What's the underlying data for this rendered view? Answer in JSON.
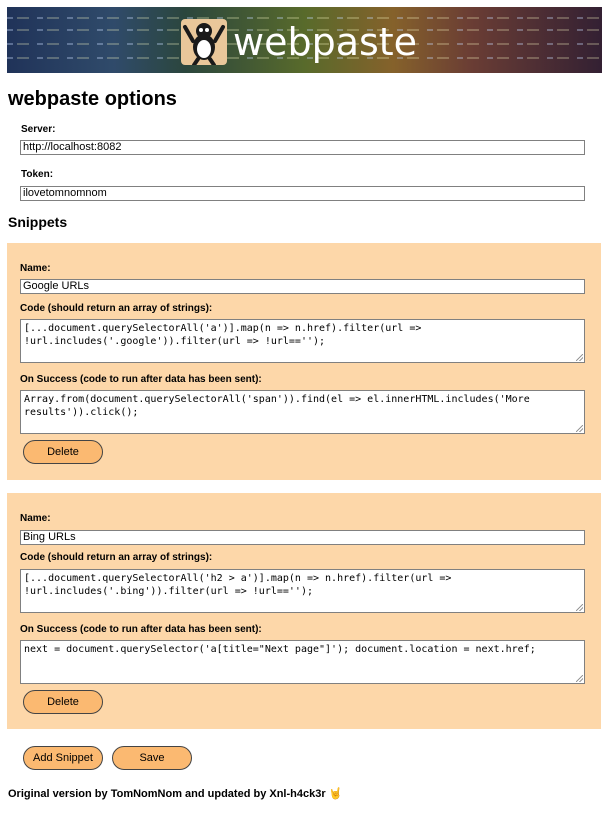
{
  "banner": {
    "logo_text": "webpaste"
  },
  "page_title": "webpaste options",
  "server": {
    "label": "Server:",
    "value": "http://localhost:8082"
  },
  "token": {
    "label": "Token:",
    "value": "ilovetomnomnom"
  },
  "snippets_heading": "Snippets",
  "snippet_labels": {
    "name": "Name:",
    "code": "Code (should return an array of strings):",
    "on_success": "On Success (code to run after data has been sent):",
    "delete": "Delete"
  },
  "snippets": [
    {
      "name": "Google URLs",
      "code": "[...document.querySelectorAll('a')].map(n => n.href).filter(url =>\n!url.includes('.google')).filter(url => !url=='');",
      "on_success": "Array.from(document.querySelectorAll('span')).find(el => el.innerHTML.includes('More\nresults')).click();"
    },
    {
      "name": "Bing URLs",
      "code": "[...document.querySelectorAll('h2 > a')].map(n => n.href).filter(url =>\n!url.includes('.bing')).filter(url => !url=='');",
      "on_success": "next = document.querySelector('a[title=\"Next page\"]'); document.location = next.href;"
    }
  ],
  "actions": {
    "add_snippet": "Add Snippet",
    "save": "Save"
  },
  "footer": {
    "text": "Original version by TomNomNom and updated by Xnl-h4ck3r",
    "emoji": "🤘"
  }
}
